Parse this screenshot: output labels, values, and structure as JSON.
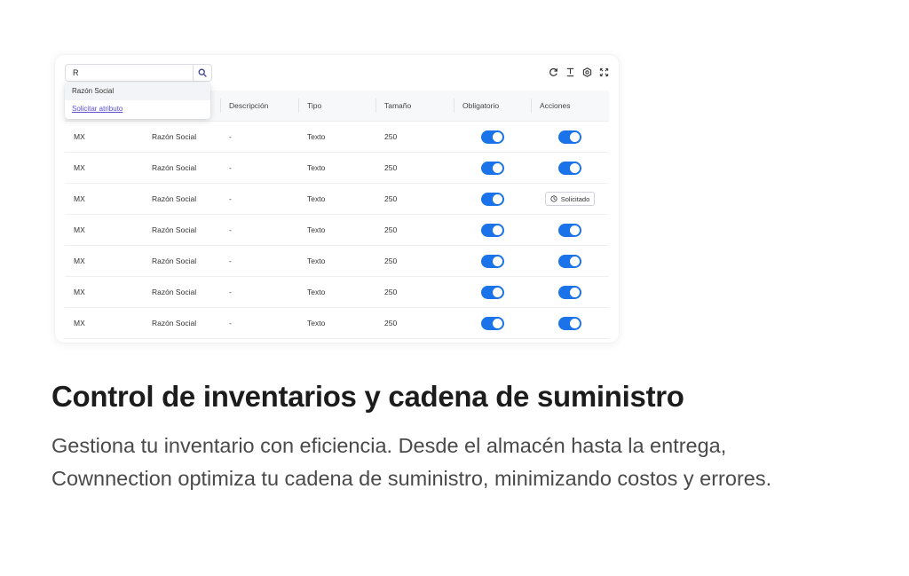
{
  "search": {
    "value": "R"
  },
  "dropdown": {
    "suggestion": "Razón Social",
    "request_link": "Solicitar atributo"
  },
  "toolbar": {
    "icons": [
      "refresh-icon",
      "text-cursor-icon",
      "settings-icon",
      "fullscreen-icon"
    ]
  },
  "table": {
    "columns": [
      "",
      "",
      "Descripción",
      "Tipo",
      "Tamaño",
      "Obligatorio",
      "Acciones"
    ],
    "rows": [
      {
        "country": "MX",
        "name": "Razón Social",
        "description": "-",
        "type": "Texto",
        "size": "250",
        "required": true,
        "action": "toggle"
      },
      {
        "country": "MX",
        "name": "Razón Social",
        "description": "-",
        "type": "Texto",
        "size": "250",
        "required": true,
        "action": "toggle"
      },
      {
        "country": "MX",
        "name": "Razón Social",
        "description": "-",
        "type": "Texto",
        "size": "250",
        "required": true,
        "action": "badge",
        "badge": "Solicitado"
      },
      {
        "country": "MX",
        "name": "Razón Social",
        "description": "-",
        "type": "Texto",
        "size": "250",
        "required": true,
        "action": "toggle"
      },
      {
        "country": "MX",
        "name": "Razón Social",
        "description": "-",
        "type": "Texto",
        "size": "250",
        "required": true,
        "action": "toggle"
      },
      {
        "country": "MX",
        "name": "Razón Social",
        "description": "-",
        "type": "Texto",
        "size": "250",
        "required": true,
        "action": "toggle"
      },
      {
        "country": "MX",
        "name": "Razón Social",
        "description": "-",
        "type": "Texto",
        "size": "250",
        "required": true,
        "action": "toggle"
      }
    ]
  },
  "colors": {
    "accent": "#1a73e8",
    "link": "#5b4fd6"
  },
  "heading": "Control de inventarios y cadena de suministro",
  "description": "Gestiona tu inventario con eficiencia. Desde el almacén hasta la entrega, Cownnection optimiza tu cadena de suministro, minimizando costos y errores."
}
